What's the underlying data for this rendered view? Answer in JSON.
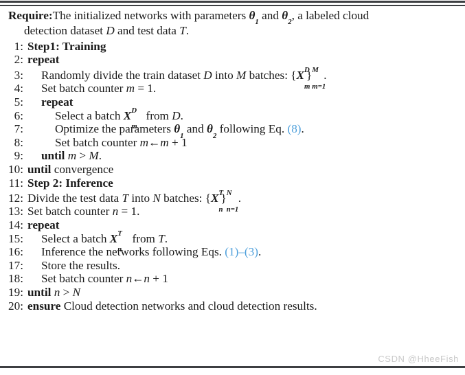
{
  "document": {
    "type": "algorithm-pseudocode",
    "require": {
      "keyword": "Require:",
      "text_part1": "The initialized networks with parameters ",
      "theta1": "θ",
      "theta1_sub": "1",
      "text_and": " and ",
      "theta2": "θ",
      "theta2_sub": "2",
      "text_part2": ", a labeled cloud",
      "line2": "detection dataset ",
      "line2_var_D": "D",
      "line2_mid": " and test data ",
      "line2_var_T": "T",
      "line2_end": "."
    },
    "lines": [
      {
        "number": "1:",
        "indent": 0,
        "text": "Step1: Training",
        "style": "bold"
      },
      {
        "number": "2:",
        "indent": 0,
        "text": "repeat",
        "style": "bold"
      },
      {
        "number": "3:",
        "indent": 1,
        "text_before": "Randomly divide the train dataset ",
        "var_a": "D",
        "text_mid": " into ",
        "var_b": "M",
        "text_after": " batches: ",
        "math": "{X_m^D}_{m=1}^M .",
        "math_base": "X",
        "math_sup": "D",
        "math_sub": "m",
        "math_limit_lower": "m=1",
        "math_limit_upper": "M"
      },
      {
        "number": "4:",
        "indent": 1,
        "text_before": "Set batch counter ",
        "var_a": "m",
        "text_after": " = 1."
      },
      {
        "number": "5:",
        "indent": 1,
        "text": "repeat",
        "style": "bold"
      },
      {
        "number": "6:",
        "indent": 2,
        "text_before": "Select a batch ",
        "math_base": "X",
        "math_sup": "D",
        "math_sub": "m",
        "text_mid": " from ",
        "var_b": "D",
        "text_after": "."
      },
      {
        "number": "7:",
        "indent": 2,
        "text_before": "Optimize the parameters ",
        "theta1": "θ",
        "theta1_sub": "1",
        "text_mid": " and ",
        "theta2": "θ",
        "theta2_sub": "2",
        "text_after": " following Eq. ",
        "eqref": "(8)",
        "text_end": "."
      },
      {
        "number": "8:",
        "indent": 2,
        "text_before": "Set batch counter ",
        "var_a": "m",
        "arrow": "←",
        "var_b": "m",
        "text_after": " + 1"
      },
      {
        "number": "9:",
        "indent": 1,
        "keyword": "until",
        "var_a": "m",
        "operator": " > ",
        "var_b": "M",
        "text_after": "."
      },
      {
        "number": "10:",
        "indent": 0,
        "keyword": "until",
        "text_after": " convergence"
      },
      {
        "number": "11:",
        "indent": 0,
        "text": "Step 2: Inference",
        "style": "bold"
      },
      {
        "number": "12:",
        "indent": 0,
        "text_before": "Divide the test data ",
        "var_a": "T",
        "text_mid": " into ",
        "var_b": "N",
        "text_after": " batches: ",
        "math_base": "X",
        "math_sup": "T",
        "math_sub": "n",
        "math_limit_lower": "n=1",
        "math_limit_upper": "N"
      },
      {
        "number": "13:",
        "indent": 0,
        "text_before": "Set batch counter ",
        "var_a": "n",
        "text_after": " = 1."
      },
      {
        "number": "14:",
        "indent": 0,
        "text": "repeat",
        "style": "bold"
      },
      {
        "number": "15:",
        "indent": 1,
        "text_before": "Select a batch ",
        "math_base": "X",
        "math_sup": "T",
        "math_sub": "n",
        "text_mid": " from ",
        "var_b": "T",
        "text_after": "."
      },
      {
        "number": "16:",
        "indent": 1,
        "text_before": "Inference the networks following Eqs. ",
        "eqref1": "(1)",
        "dash": "–",
        "eqref2": "(3)",
        "text_end": "."
      },
      {
        "number": "17:",
        "indent": 1,
        "text": "Store the results."
      },
      {
        "number": "18:",
        "indent": 1,
        "text_before": "Set batch counter ",
        "var_a": "n",
        "arrow": "←",
        "var_b": "n",
        "text_after": " + 1"
      },
      {
        "number": "19:",
        "indent": 0,
        "keyword": "until",
        "var_a": "n",
        "operator": " > ",
        "var_b": "N"
      },
      {
        "number": "20:",
        "indent": 0,
        "keyword": "ensure",
        "text_after": " Cloud detection networks and cloud detection results."
      }
    ]
  },
  "watermark": {
    "text": "CSDN @HheeFish"
  },
  "colors": {
    "text": "#1a1a1a",
    "equation_reference": "#4d9fdb",
    "rule": "#3d3f42",
    "watermark": "#c9c9c9",
    "background": "#ffffff"
  }
}
